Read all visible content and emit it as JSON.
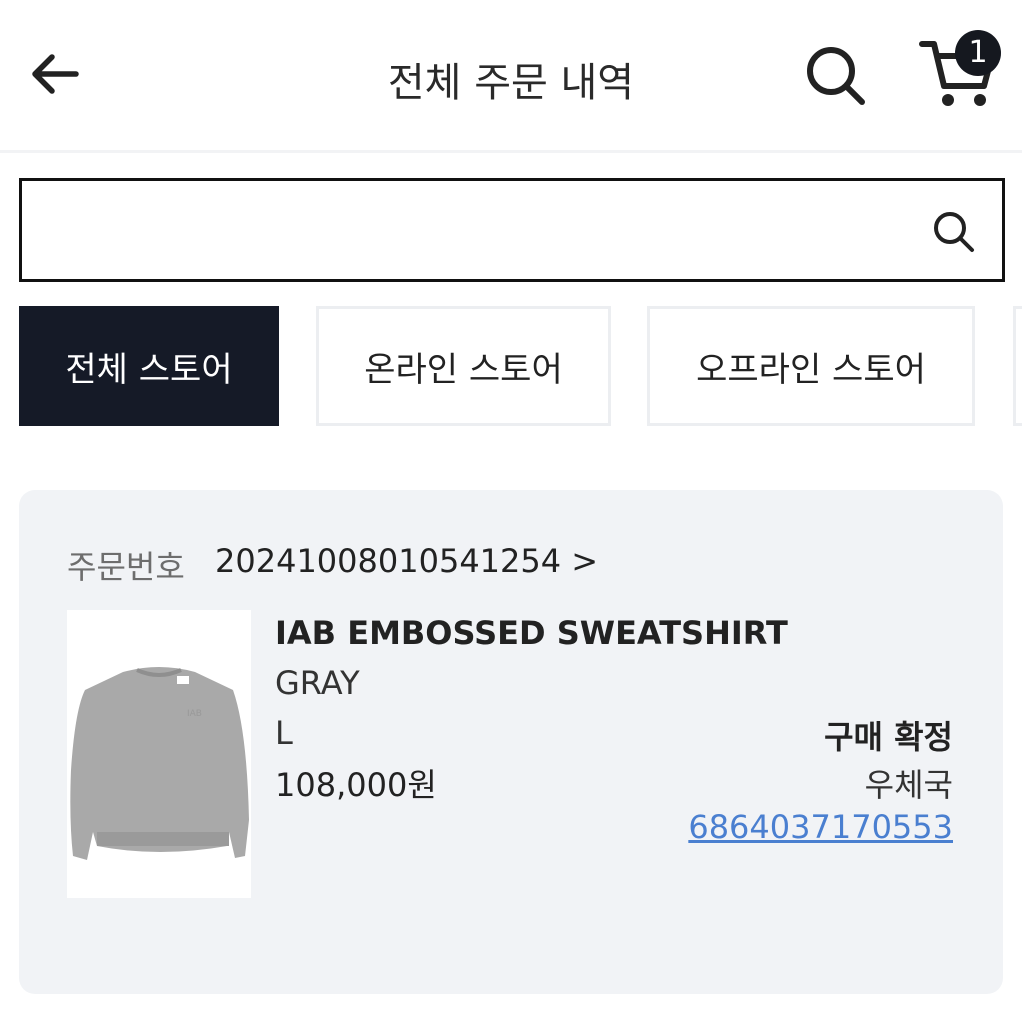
{
  "header": {
    "title": "전체 주문 내역",
    "back_icon": "arrow-left-icon",
    "search_icon": "search-icon",
    "cart_icon": "cart-icon",
    "cart_count": "1"
  },
  "search": {
    "value": "",
    "placeholder": "",
    "icon": "search-icon"
  },
  "tabs": [
    {
      "label": "전체 스토어",
      "active": true
    },
    {
      "label": "온라인 스토어",
      "active": false
    },
    {
      "label": "오프라인 스토어",
      "active": false
    }
  ],
  "order": {
    "number_label": "주문번호",
    "number": "20241008010541254 >",
    "product": {
      "name": "IAB EMBOSSED SWEATSHIRT",
      "color": "GRAY",
      "size": "L",
      "price": "108,000원"
    },
    "status": "구매 확정",
    "carrier": "우체국",
    "tracking_number": "6864037170553"
  },
  "colors": {
    "active_tab": "#151a27",
    "card_bg": "#f1f3f6",
    "link": "#4a7fd0"
  }
}
